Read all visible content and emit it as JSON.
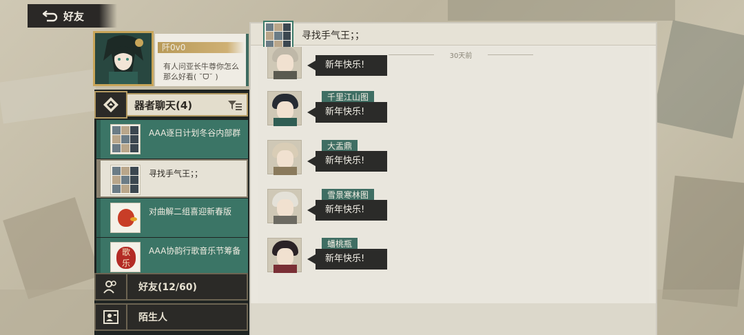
{
  "top_bar": {
    "back_label": "好友"
  },
  "profile": {
    "name": "阡0v0",
    "signature": "有人问亚长牛尊你怎么那么好看( ˘ᗜ˘ )"
  },
  "sidebar": {
    "category": {
      "label": "器者聊天(4)"
    },
    "groups": [
      {
        "name": "AAA逐日计划冬谷内部群",
        "avatar": "group-collage"
      },
      {
        "name": "寻找手气王；；",
        "avatar": "group-collage",
        "active": true
      },
      {
        "name": "对曲解二组喜迎新春版",
        "avatar": "red-duck-icon"
      },
      {
        "name": "AAA协韵行歌音乐节筹备",
        "avatar": "lantern-icon",
        "avatar_text": "歌\n乐"
      }
    ],
    "friends_label": "好友(12/60)",
    "strangers_label": "陌生人"
  },
  "chat": {
    "title": "寻找手气王；；",
    "time_divider": "30天前",
    "messages": [
      {
        "sender": "",
        "text": "新年快乐!"
      },
      {
        "sender": "千里江山图",
        "text": "新年快乐!"
      },
      {
        "sender": "大盂鼎",
        "text": "新年快乐!"
      },
      {
        "sender": "雪景寒林图",
        "text": "新年快乐!"
      },
      {
        "sender": "蟠桃瓶",
        "text": "新年快乐!"
      }
    ]
  },
  "colors": {
    "accent_green": "#3b7566",
    "gold_border": "#b39a62",
    "bubble_dark": "#2b2b29"
  }
}
